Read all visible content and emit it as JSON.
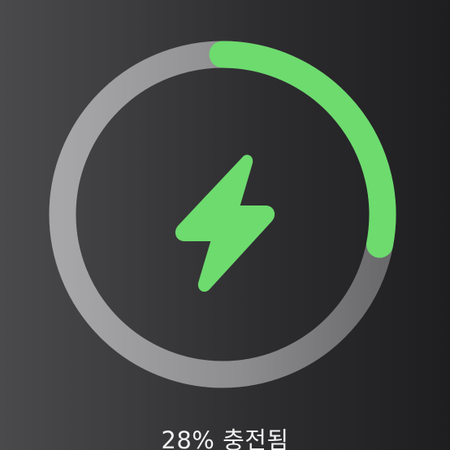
{
  "battery": {
    "level_fraction": 0.28,
    "status_text": "28% 충전됨",
    "charging": true
  },
  "colors": {
    "accent": "#6ddb6e",
    "ring_track": "#8a8a8c"
  },
  "icons": {
    "center": "lightning-bolt-icon"
  }
}
